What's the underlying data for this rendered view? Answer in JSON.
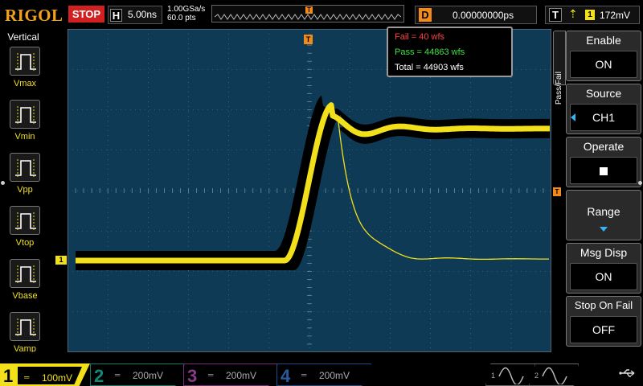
{
  "brand": "RIGOL",
  "run_state": "STOP",
  "horizontal": {
    "label": "H",
    "timebase": "5.00ns"
  },
  "sampling": {
    "rate": "1.00GSa/s",
    "points": "60.0 pts"
  },
  "memory_trigger_marker": "T",
  "delay": {
    "label": "D",
    "value": "0.00000000ps"
  },
  "trigger": {
    "label": "T",
    "edge_icon": "rising-edge-icon",
    "source": "1",
    "level": "172mV"
  },
  "left_panel": {
    "title": "Vertical",
    "items": [
      {
        "label": "Vmax"
      },
      {
        "label": "Vmin"
      },
      {
        "label": "Vpp"
      },
      {
        "label": "Vtop"
      },
      {
        "label": "Vbase"
      },
      {
        "label": "Vamp"
      }
    ]
  },
  "screen": {
    "ch1_marker": "1",
    "trigger_pos_marker": "T",
    "trigger_level_marker": "T"
  },
  "pass_fail": {
    "fail": "Fail   =  40 wfs",
    "pass": "Pass =  44863 wfs",
    "total": "Total  =  44903 wfs"
  },
  "right_menu": {
    "title": "Pass/Fail",
    "items": [
      {
        "label": "Enable",
        "value": "ON"
      },
      {
        "label": "Source",
        "value": "CH1"
      },
      {
        "label": "Operate",
        "value": ""
      },
      {
        "label": "Range",
        "value": ""
      },
      {
        "label": "Msg Disp",
        "value": "ON"
      },
      {
        "label": "Stop On Fail",
        "value": "OFF"
      }
    ]
  },
  "channels": [
    {
      "num": "1",
      "scale": "100mV",
      "coupling": "DC",
      "color": "#f2e01a"
    },
    {
      "num": "2",
      "scale": "200mV",
      "coupling": "DC",
      "color": "#138a78"
    },
    {
      "num": "3",
      "scale": "200mV",
      "coupling": "DC",
      "color": "#8a3a8a"
    },
    {
      "num": "4",
      "scale": "200mV",
      "coupling": "DC",
      "color": "#2a5aa0"
    }
  ],
  "sources": [
    {
      "num": "1",
      "icon": "sine-wave-icon"
    },
    {
      "num": "2",
      "icon": "sine-wave-icon"
    }
  ],
  "colors": {
    "screen_bg": "#0f3a56",
    "trace": "#f2e01a",
    "accent": "#f2a21a",
    "menu_arrow": "#36b4f0",
    "stop": "#d02020"
  }
}
